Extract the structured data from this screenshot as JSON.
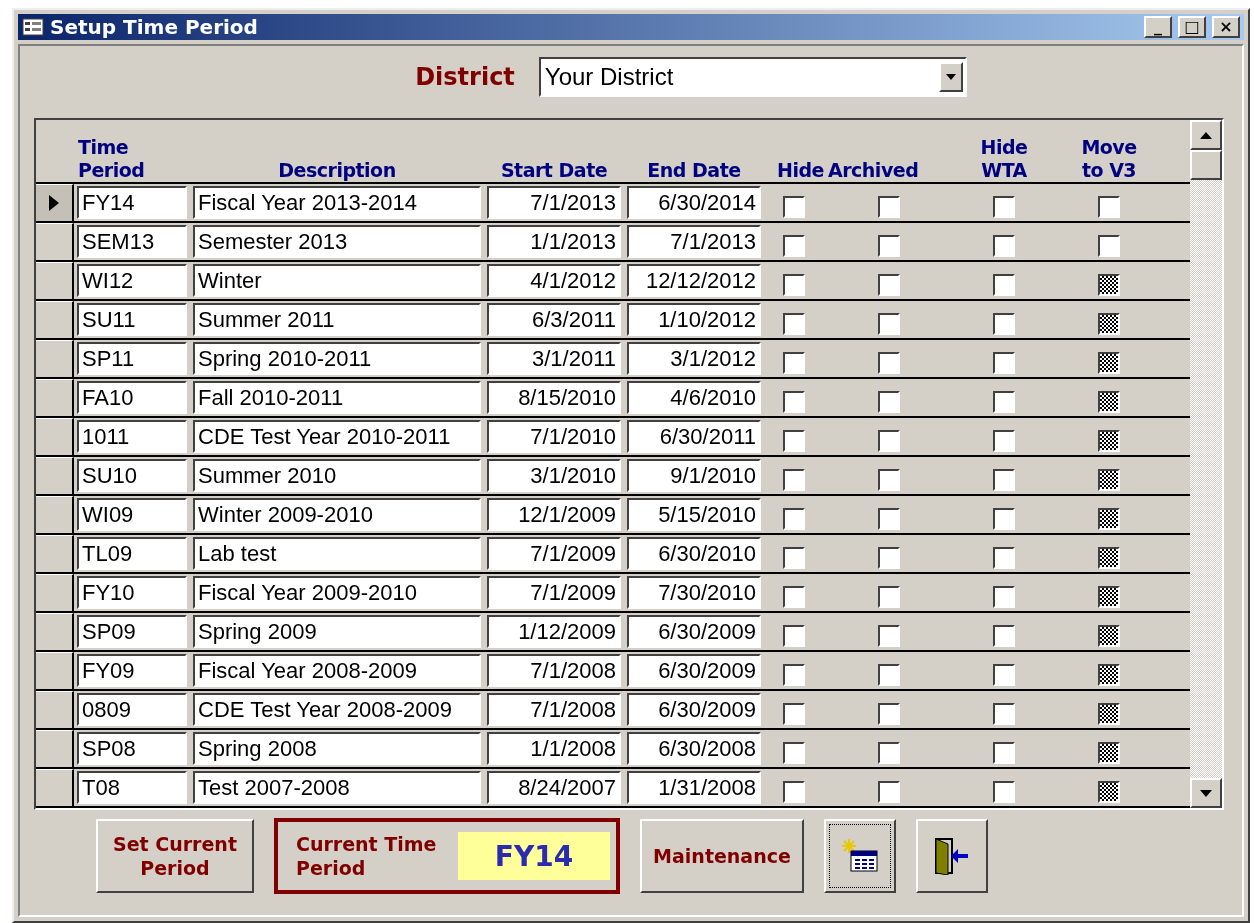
{
  "window": {
    "title": "Setup Time Period",
    "controls": [
      "_",
      "□",
      "×"
    ]
  },
  "district": {
    "label": "District",
    "value": "Your District"
  },
  "table": {
    "columns": [
      "Time Period",
      "Description",
      "Start Date",
      "End Date",
      "Hide",
      "Archived",
      "Hide WTA",
      "Move to V3"
    ],
    "rows": [
      {
        "selected": true,
        "period": "FY14",
        "description": "Fiscal Year 2013-2014",
        "start": "7/1/2013",
        "end": "6/30/2014",
        "hide": false,
        "archived": false,
        "hide_wta": false,
        "move_to_v3_greyed": false
      },
      {
        "selected": false,
        "period": "SEM13",
        "description": "Semester 2013",
        "start": "1/1/2013",
        "end": "7/1/2013",
        "hide": false,
        "archived": false,
        "hide_wta": false,
        "move_to_v3_greyed": false
      },
      {
        "selected": false,
        "period": "WI12",
        "description": "Winter",
        "start": "4/1/2012",
        "end": "12/12/2012",
        "hide": false,
        "archived": false,
        "hide_wta": false,
        "move_to_v3_greyed": true
      },
      {
        "selected": false,
        "period": "SU11",
        "description": "Summer 2011",
        "start": "6/3/2011",
        "end": "1/10/2012",
        "hide": false,
        "archived": false,
        "hide_wta": false,
        "move_to_v3_greyed": true
      },
      {
        "selected": false,
        "period": "SP11",
        "description": "Spring 2010-2011",
        "start": "3/1/2011",
        "end": "3/1/2012",
        "hide": false,
        "archived": false,
        "hide_wta": false,
        "move_to_v3_greyed": true
      },
      {
        "selected": false,
        "period": "FA10",
        "description": "Fall 2010-2011",
        "start": "8/15/2010",
        "end": "4/6/2010",
        "hide": false,
        "archived": false,
        "hide_wta": false,
        "move_to_v3_greyed": true
      },
      {
        "selected": false,
        "period": "1011",
        "description": "CDE Test Year 2010-2011",
        "start": "7/1/2010",
        "end": "6/30/2011",
        "hide": false,
        "archived": false,
        "hide_wta": false,
        "move_to_v3_greyed": true
      },
      {
        "selected": false,
        "period": "SU10",
        "description": "Summer 2010",
        "start": "3/1/2010",
        "end": "9/1/2010",
        "hide": false,
        "archived": false,
        "hide_wta": false,
        "move_to_v3_greyed": true
      },
      {
        "selected": false,
        "period": "WI09",
        "description": "Winter 2009-2010",
        "start": "12/1/2009",
        "end": "5/15/2010",
        "hide": false,
        "archived": false,
        "hide_wta": false,
        "move_to_v3_greyed": true
      },
      {
        "selected": false,
        "period": "TL09",
        "description": "Lab test",
        "start": "7/1/2009",
        "end": "6/30/2010",
        "hide": false,
        "archived": false,
        "hide_wta": false,
        "move_to_v3_greyed": true
      },
      {
        "selected": false,
        "period": "FY10",
        "description": "Fiscal Year 2009-2010",
        "start": "7/1/2009",
        "end": "7/30/2010",
        "hide": false,
        "archived": false,
        "hide_wta": false,
        "move_to_v3_greyed": true
      },
      {
        "selected": false,
        "period": "SP09",
        "description": "Spring 2009",
        "start": "1/12/2009",
        "end": "6/30/2009",
        "hide": false,
        "archived": false,
        "hide_wta": false,
        "move_to_v3_greyed": true
      },
      {
        "selected": false,
        "period": "FY09",
        "description": "Fiscal Year 2008-2009",
        "start": "7/1/2008",
        "end": "6/30/2009",
        "hide": false,
        "archived": false,
        "hide_wta": false,
        "move_to_v3_greyed": true
      },
      {
        "selected": false,
        "period": "0809",
        "description": "CDE Test Year 2008-2009",
        "start": "7/1/2008",
        "end": "6/30/2009",
        "hide": false,
        "archived": false,
        "hide_wta": false,
        "move_to_v3_greyed": true
      },
      {
        "selected": false,
        "period": "SP08",
        "description": "Spring 2008",
        "start": "1/1/2008",
        "end": "6/30/2008",
        "hide": false,
        "archived": false,
        "hide_wta": false,
        "move_to_v3_greyed": true
      },
      {
        "selected": false,
        "period": "T08",
        "description": "Test  2007-2008",
        "start": "8/24/2007",
        "end": "1/31/2008",
        "hide": false,
        "archived": false,
        "hide_wta": false,
        "move_to_v3_greyed": true
      }
    ]
  },
  "footer": {
    "set_button": "Set Current Period",
    "current_label": "Current Time Period",
    "current_value": "FY14",
    "maintenance_button": "Maintenance"
  }
}
